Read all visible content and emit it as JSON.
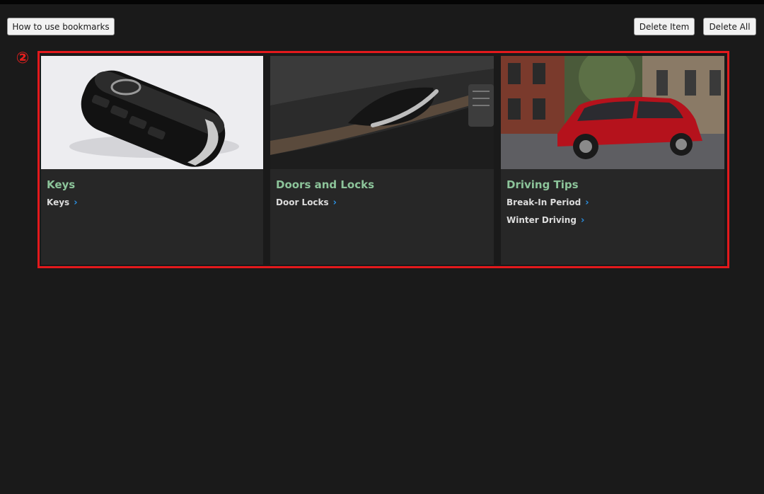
{
  "toolbar": {
    "howto_label": "How to use bookmarks",
    "delete_item_label": "Delete Item",
    "delete_all_label": "Delete All"
  },
  "annotation": {
    "marker": "②",
    "color": "#e3191c"
  },
  "cards": [
    {
      "title": "Keys",
      "image": "smart-key-fob",
      "links": [
        {
          "label": "Keys"
        }
      ]
    },
    {
      "title": "Doors and Locks",
      "image": "door-interior-handle",
      "links": [
        {
          "label": "Door Locks"
        }
      ]
    },
    {
      "title": "Driving Tips",
      "image": "red-suv-street",
      "links": [
        {
          "label": "Break-In Period"
        },
        {
          "label": "Winter Driving"
        }
      ]
    }
  ],
  "colors": {
    "background": "#1a1a1a",
    "card": "#272727",
    "title": "#8cc49a",
    "chevron": "#2a8fe0"
  }
}
